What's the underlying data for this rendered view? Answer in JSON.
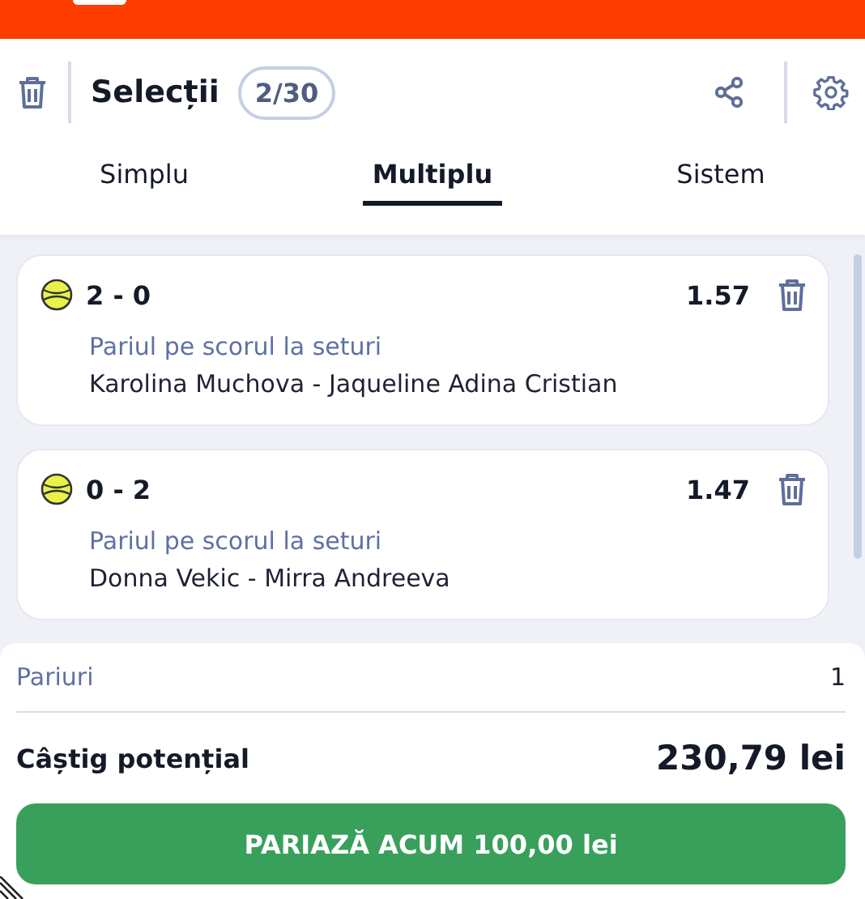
{
  "header": {
    "title": "Selecții",
    "count": "2/30"
  },
  "tabs": [
    {
      "label": "Simplu",
      "selected": false
    },
    {
      "label": "Multiplu",
      "selected": true
    },
    {
      "label": "Sistem",
      "selected": false
    }
  ],
  "selections": [
    {
      "score": "2 - 0",
      "odds": "1.57",
      "market": "Pariul pe scorul la seturi",
      "match": "Karolina Muchova - Jaqueline Adina Cristian"
    },
    {
      "score": "0 - 2",
      "odds": "1.47",
      "market": "Pariul pe scorul la seturi",
      "match": "Donna Vekic - Mirra Andreeva"
    }
  ],
  "summary": {
    "bets_label": "Pariuri",
    "bets_value": "1",
    "win_label": "Câștig potențial",
    "win_value": "230,79 lei"
  },
  "place_button": "PARIAZĂ ACUM 100,00 lei"
}
